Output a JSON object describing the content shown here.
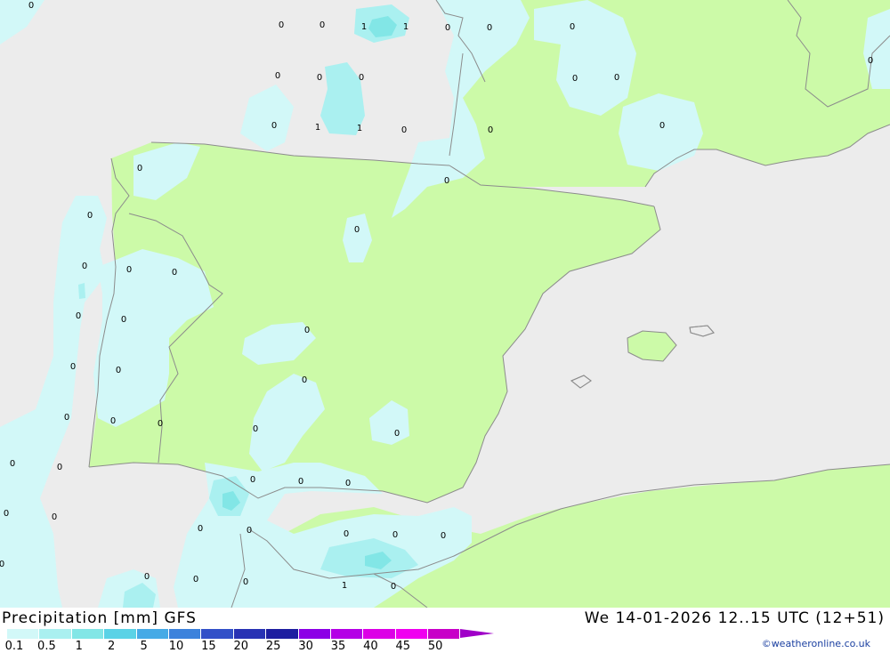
{
  "map": {
    "colors": {
      "sea": "#ececec",
      "land_dry": "#ccfaa8",
      "precip_0_1": "#d2f8f8",
      "precip_0_5": "#aaf0f0",
      "precip_1": "#82e6e6",
      "border": "#8c8c8c"
    },
    "contour_labels": [
      "0",
      "0",
      "0",
      "1",
      "1",
      "0",
      "0",
      "0",
      "0",
      "0",
      "0",
      "0",
      "0",
      "1",
      "1",
      "0",
      "0",
      "0",
      "0",
      "0",
      "0",
      "0",
      "0",
      "0",
      "0",
      "0",
      "0",
      "0",
      "0",
      "0",
      "0",
      "0",
      "0",
      "0",
      "0",
      "0",
      "0",
      "0",
      "0",
      "0",
      "0",
      "0",
      "0",
      "0",
      "0",
      "0",
      "0",
      "0",
      "0",
      "0",
      "0",
      "0",
      "0",
      "0",
      "1",
      "0"
    ]
  },
  "title": {
    "left": "Precipitation [mm] GFS",
    "right": "We 14-01-2026 12..15 UTC (12+51)"
  },
  "legend": {
    "tick_labels": [
      "0.1",
      "0.5",
      "1",
      "2",
      "5",
      "10",
      "15",
      "20",
      "25",
      "30",
      "35",
      "40",
      "45",
      "50"
    ],
    "colors": [
      "#d2f8f8",
      "#aaf0f0",
      "#82e6e6",
      "#5ad2e6",
      "#46aae6",
      "#3c82dc",
      "#3250c8",
      "#2832b4",
      "#1e1ea0",
      "#8c00e6",
      "#b400e6",
      "#dc00e6",
      "#f000f0",
      "#c800c8"
    ],
    "arrow_color": "#a000c8"
  },
  "credit": "©weatheronline.co.uk"
}
